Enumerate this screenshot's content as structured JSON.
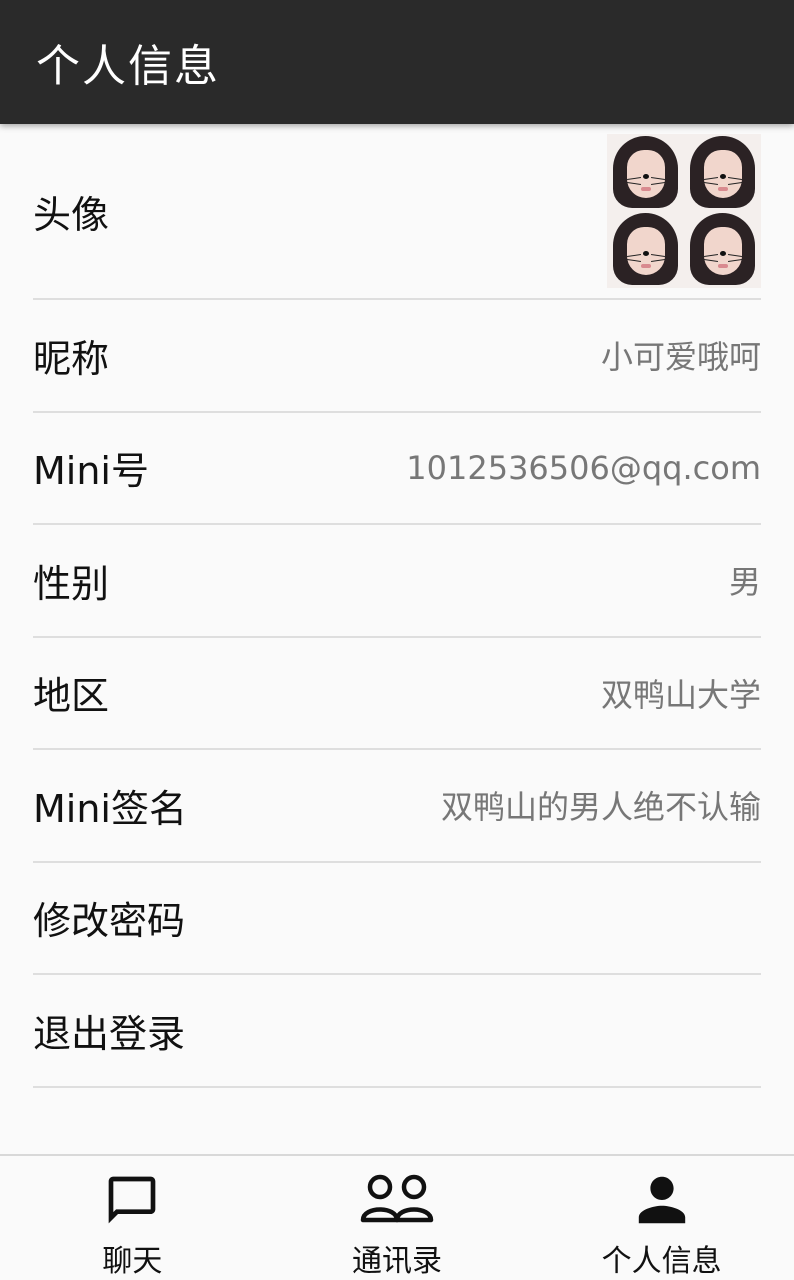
{
  "header": {
    "title": "个人信息"
  },
  "profile": {
    "rows": [
      {
        "label": "头像",
        "value": ""
      },
      {
        "label": "昵称",
        "value": "小可爱哦呵"
      },
      {
        "label": "Mini号",
        "value": "1012536506@qq.com"
      },
      {
        "label": "性别",
        "value": "男"
      },
      {
        "label": "地区",
        "value": "双鸭山大学"
      },
      {
        "label": "Mini签名",
        "value": "双鸭山的男人绝不认输"
      },
      {
        "label": "修改密码",
        "value": ""
      },
      {
        "label": "退出登录",
        "value": ""
      }
    ]
  },
  "bottom_nav": {
    "items": [
      {
        "label": "聊天",
        "icon": "chat-bubble-icon"
      },
      {
        "label": "通讯录",
        "icon": "contacts-icon"
      },
      {
        "label": "个人信息",
        "icon": "person-icon"
      }
    ],
    "active_index": 2
  },
  "colors": {
    "appbar": "#2a2a2a",
    "background": "#fafafa",
    "value_text": "#777777",
    "divider": "#dedede"
  }
}
